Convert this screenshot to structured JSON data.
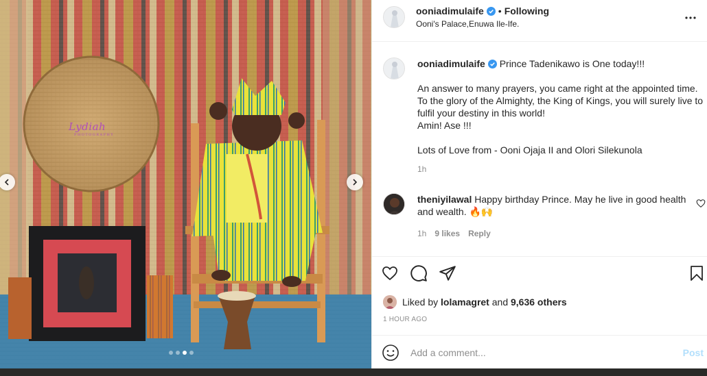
{
  "post": {
    "username": "ooniadimulaife",
    "follow_state": "Following",
    "separator": "•",
    "location": "Ooni's Palace,Enuwa Ile-Ife.",
    "more_icon": "more-options-icon"
  },
  "caption": {
    "username": "ooniadimulaife",
    "first_line": "Prince Tadenikawo is One today!!!",
    "paragraph": "An answer to many prayers, you came right at the appointed time. To the glory of the Almighty, the King of Kings, you will surely live to fulfil your destiny in this world!",
    "amen": "Amin! Ase !!!",
    "signoff": "Lots of Love from - Ooni Ojaja II and Olori Silekunola",
    "time": "1h"
  },
  "comment": {
    "username": "theniyilawal",
    "text": "Happy birthday Prince. May he live in good health and wealth. 🔥🙌",
    "time": "1h",
    "likes": "9 likes",
    "reply": "Reply"
  },
  "likes": {
    "prefix": "Liked by",
    "first_liker": "lolamagret",
    "connector": "and",
    "others": "9,636 others"
  },
  "posted_ago": "1 HOUR AGO",
  "add_comment": {
    "placeholder": "Add a comment...",
    "post_label": "Post"
  },
  "media": {
    "watermark": "Lydiah",
    "watermark_sub": "PHOTOGRAPHY",
    "carousel_count": 4,
    "carousel_active_index": 2
  },
  "colors": {
    "verified_blue": "#3897f0",
    "post_disabled": "#b2dffc",
    "muted_text": "#8e8e8e"
  }
}
